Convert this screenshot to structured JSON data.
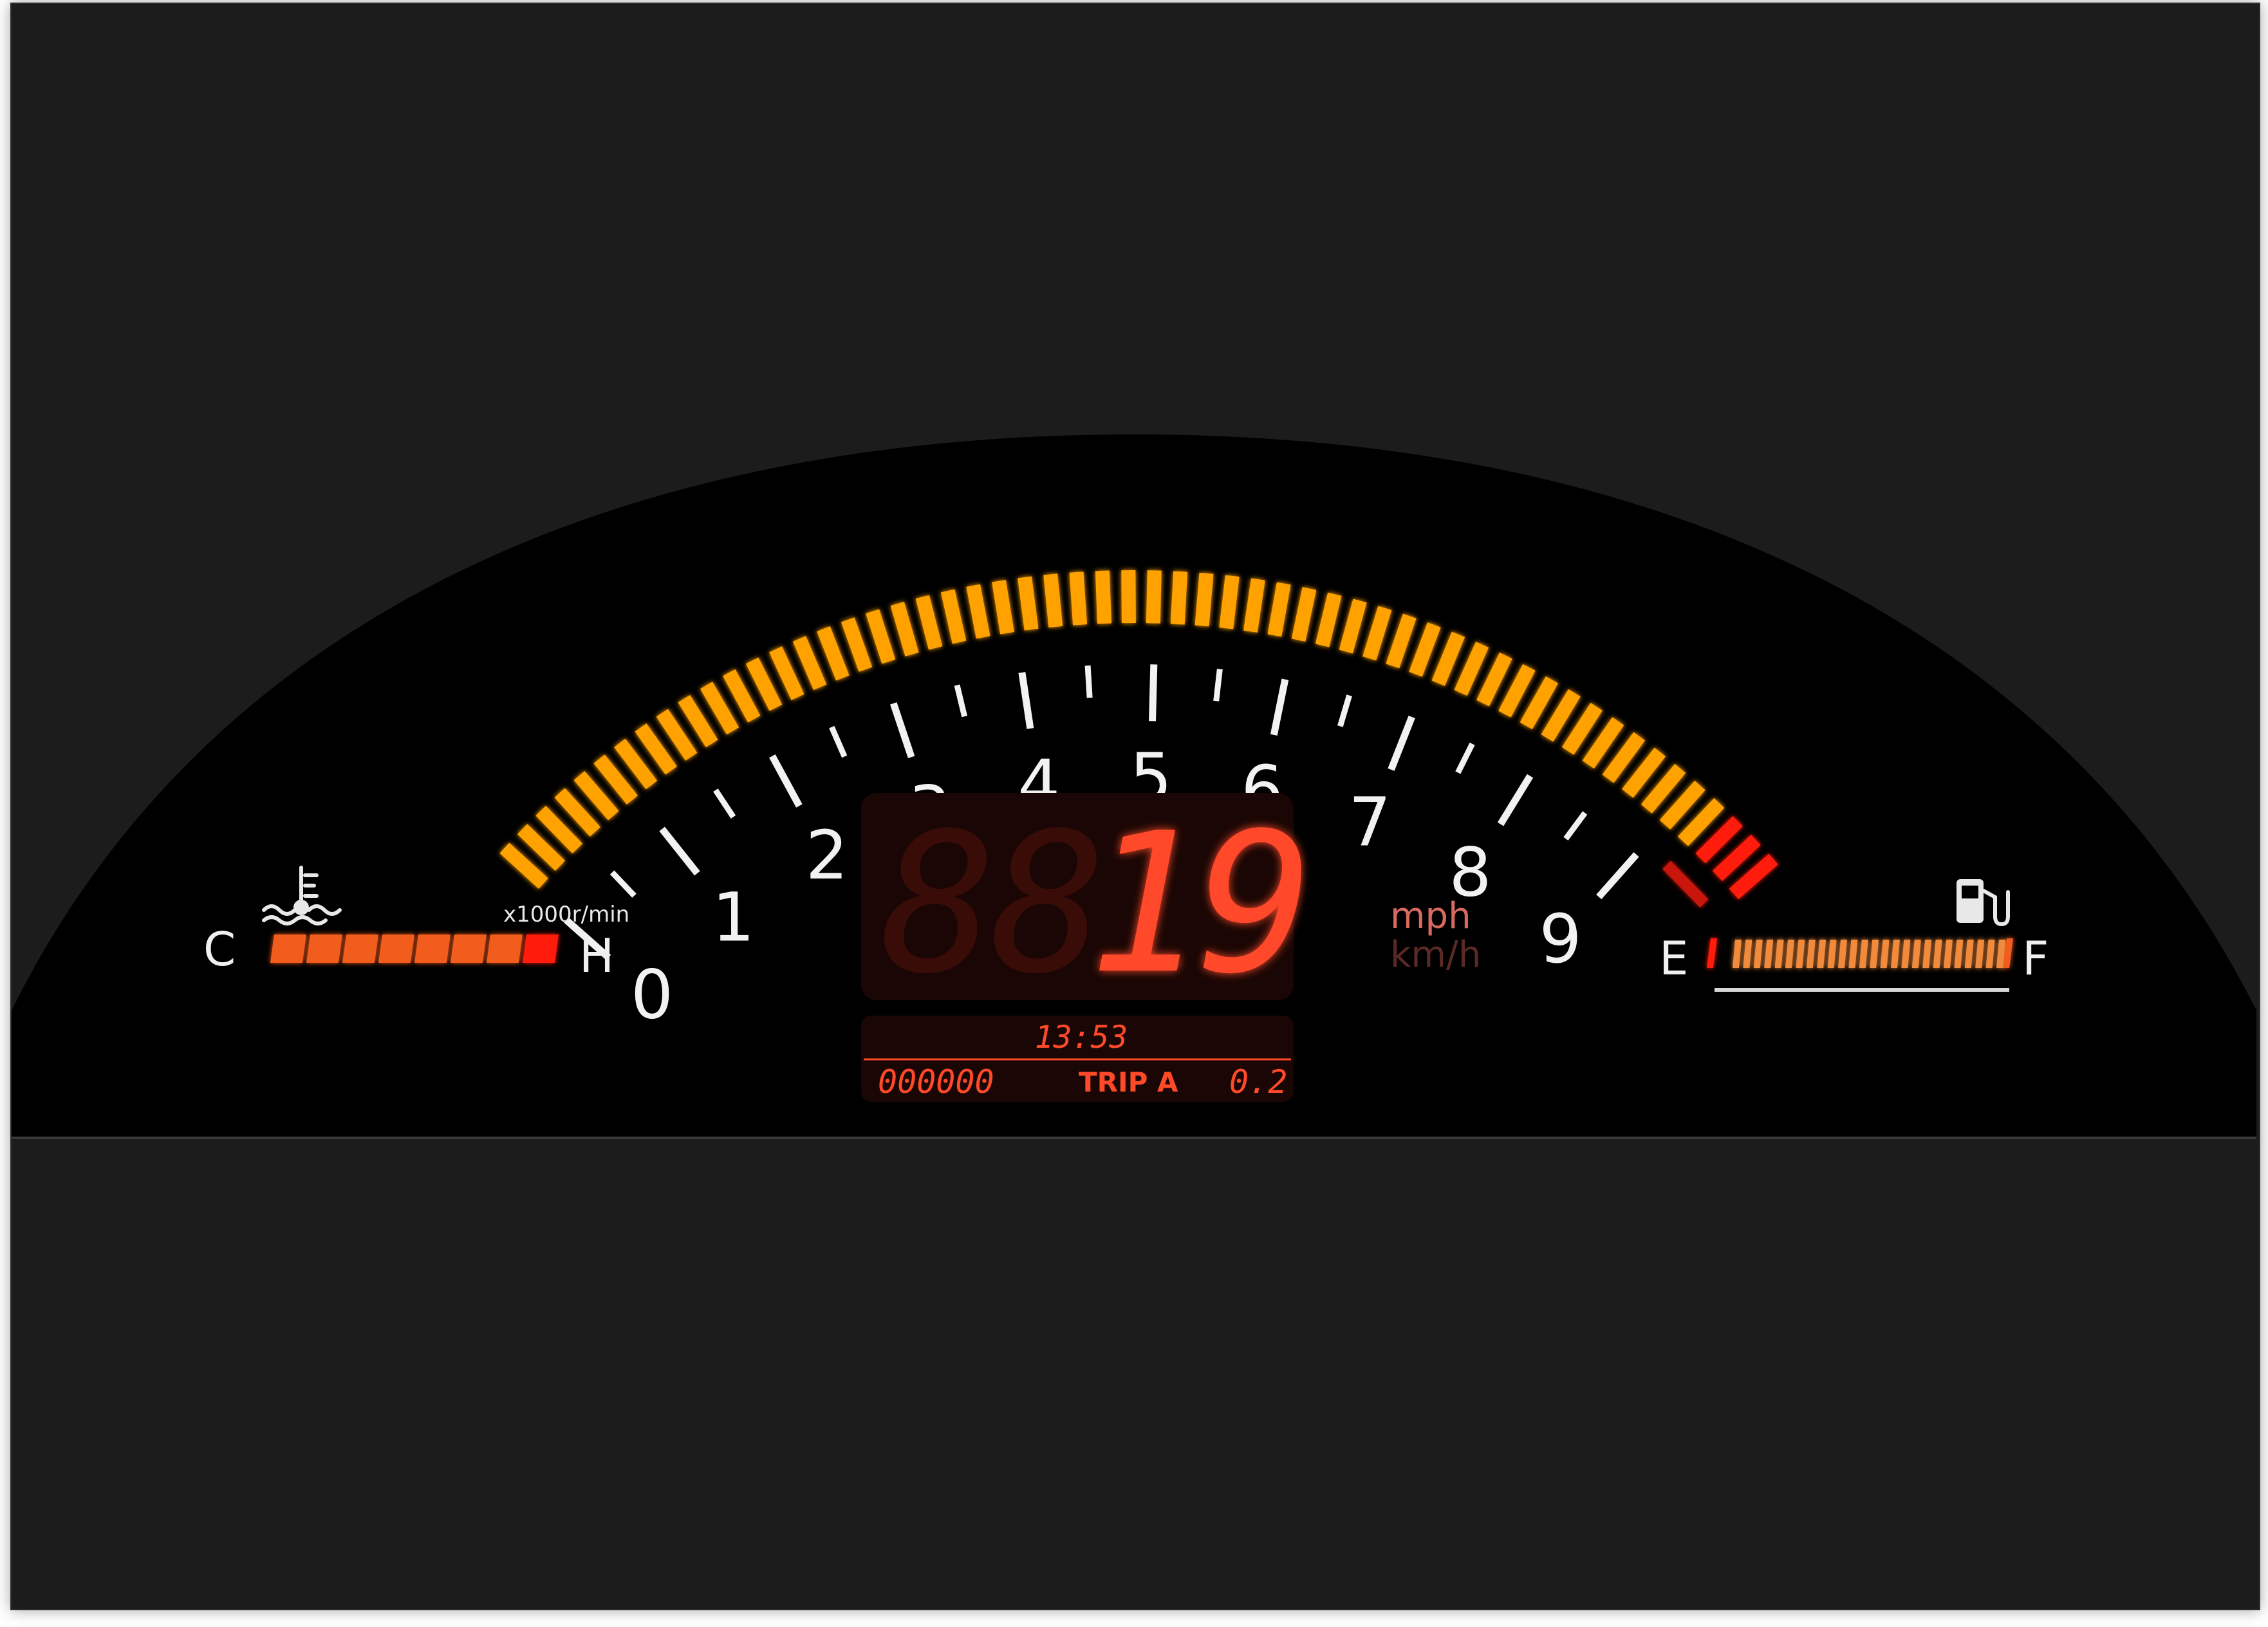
{
  "tachometer": {
    "unit_label": "x1000r/min",
    "scale_numbers": [
      "0",
      "1",
      "2",
      "3",
      "4",
      "5",
      "6",
      "7",
      "8",
      "9"
    ],
    "rpm_max": 9.8,
    "redline_from": 9.3,
    "current_fill": 1.0
  },
  "speed": {
    "value": "19",
    "ghost": "88",
    "unit_active": "mph",
    "unit_inactive": "km/h"
  },
  "clock": {
    "time": "13:53"
  },
  "odometer": {
    "total": "000000",
    "trip_label": "TRIP A",
    "trip_value": "0.2"
  },
  "temperature": {
    "cold_label": "C",
    "hot_label": "H",
    "icon": "coolant-temperature-icon",
    "segments_total": 8,
    "level_fraction": 1.0
  },
  "fuel": {
    "empty_label": "E",
    "full_label": "F",
    "icon": "fuel-pump-icon",
    "segments_total": 26,
    "level_fraction": 1.0
  },
  "colors": {
    "tach_segment": "#ffa200",
    "redline_segment": "#ff1a0a",
    "display_red": "#ff4a2a",
    "temp_bar": "#f25c1c",
    "fuel_bar": "#f08a3c",
    "background": "#1c1c1c",
    "cluster": "#000000"
  }
}
